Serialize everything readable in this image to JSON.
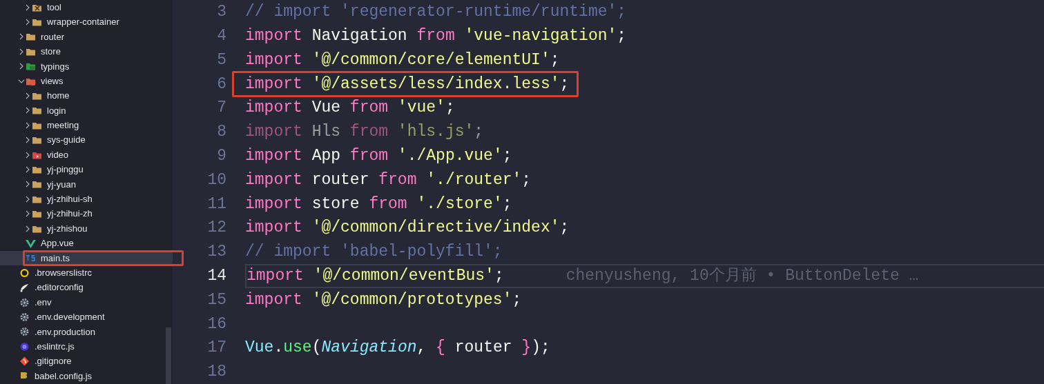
{
  "explorer": {
    "items": [
      {
        "children": [
          {
            "children": [
              {
                "label": "tool",
                "kind": "tools-folder",
                "expanded": false,
                "selected": false,
                "annotated": false
              },
              {
                "label": "wrapper-container",
                "kind": "folder",
                "expanded": false,
                "selected": false,
                "annotated": false
              }
            ]
          },
          {
            "label": "router",
            "kind": "folder",
            "expanded": false,
            "selected": false,
            "annotated": false
          },
          {
            "label": "store",
            "kind": "folder",
            "expanded": false,
            "selected": false,
            "annotated": false
          },
          {
            "label": "typings",
            "kind": "typescript-folder",
            "expanded": false,
            "selected": false,
            "annotated": false
          },
          {
            "label": "views",
            "kind": "views-folder",
            "expanded": true,
            "selected": false,
            "annotated": false,
            "children": [
              {
                "label": "home",
                "kind": "folder",
                "expanded": false,
                "selected": false,
                "annotated": false
              },
              {
                "label": "login",
                "kind": "folder",
                "expanded": false,
                "selected": false,
                "annotated": false
              },
              {
                "label": "meeting",
                "kind": "folder",
                "expanded": false,
                "selected": false,
                "annotated": false
              },
              {
                "label": "sys-guide",
                "kind": "folder",
                "expanded": false,
                "selected": false,
                "annotated": false
              },
              {
                "label": "video",
                "kind": "video-folder",
                "expanded": false,
                "selected": false,
                "annotated": false
              },
              {
                "label": "yj-pinggu",
                "kind": "folder",
                "expanded": false,
                "selected": false,
                "annotated": false
              },
              {
                "label": "yj-yuan",
                "kind": "folder",
                "expanded": false,
                "selected": false,
                "annotated": false
              },
              {
                "label": "yj-zhihui-sh",
                "kind": "folder",
                "expanded": false,
                "selected": false,
                "annotated": false
              },
              {
                "label": "yj-zhihui-zh",
                "kind": "folder",
                "expanded": false,
                "selected": false,
                "annotated": false
              },
              {
                "label": "yj-zhishou",
                "kind": "folder",
                "expanded": false,
                "selected": false,
                "annotated": false
              }
            ]
          },
          {
            "label": "App.vue",
            "kind": "vue-file",
            "selected": false,
            "annotated": false
          },
          {
            "label": "main.ts",
            "kind": "ts-file",
            "selected": true,
            "annotated": true
          }
        ]
      },
      {
        "label": ".browserslistrc",
        "kind": "browserslist-file",
        "selected": false,
        "annotated": false
      },
      {
        "label": ".editorconfig",
        "kind": "editorconfig-file",
        "selected": false,
        "annotated": false
      },
      {
        "label": ".env",
        "kind": "env-file",
        "selected": false,
        "annotated": false
      },
      {
        "label": ".env.development",
        "kind": "env-file",
        "selected": false,
        "annotated": false
      },
      {
        "label": ".env.production",
        "kind": "env-file",
        "selected": false,
        "annotated": false
      },
      {
        "label": ".eslintrc.js",
        "kind": "eslint-file",
        "selected": false,
        "annotated": false
      },
      {
        "label": ".gitignore",
        "kind": "git-file",
        "selected": false,
        "annotated": false
      },
      {
        "label": "babel.config.js",
        "kind": "babel-file",
        "selected": false,
        "annotated": false
      }
    ]
  },
  "editor": {
    "lines": [
      {
        "number": "3",
        "current": false,
        "dimmed": false,
        "annotated": false,
        "tokens": [
          {
            "kind": "comment",
            "text": "// import 'regenerator-runtime/runtime';"
          }
        ]
      },
      {
        "number": "4",
        "current": false,
        "dimmed": false,
        "annotated": false,
        "tokens": [
          {
            "kind": "keyword",
            "text": "import"
          },
          {
            "kind": "plain",
            "text": " Navigation "
          },
          {
            "kind": "keyword",
            "text": "from"
          },
          {
            "kind": "string",
            "text": " 'vue-navigation'"
          },
          {
            "kind": "plain",
            "text": ";"
          }
        ]
      },
      {
        "number": "5",
        "current": false,
        "dimmed": false,
        "annotated": false,
        "tokens": [
          {
            "kind": "keyword",
            "text": "import"
          },
          {
            "kind": "string",
            "text": " '@/common/core/elementUI'"
          },
          {
            "kind": "plain",
            "text": ";"
          }
        ]
      },
      {
        "number": "6",
        "current": false,
        "dimmed": false,
        "annotated": true,
        "tokens": [
          {
            "kind": "keyword",
            "text": "import"
          },
          {
            "kind": "string",
            "text": " '@/assets/less/index.less'"
          },
          {
            "kind": "plain",
            "text": ";"
          }
        ]
      },
      {
        "number": "7",
        "current": false,
        "dimmed": false,
        "annotated": false,
        "tokens": [
          {
            "kind": "keyword",
            "text": "import"
          },
          {
            "kind": "plain",
            "text": " Vue "
          },
          {
            "kind": "keyword",
            "text": "from"
          },
          {
            "kind": "string",
            "text": " 'vue'"
          },
          {
            "kind": "plain",
            "text": ";"
          }
        ]
      },
      {
        "number": "8",
        "current": false,
        "dimmed": true,
        "annotated": false,
        "tokens": [
          {
            "kind": "keyword",
            "text": "import"
          },
          {
            "kind": "plain",
            "text": " Hls "
          },
          {
            "kind": "keyword",
            "text": "from"
          },
          {
            "kind": "string",
            "text": " 'hls.js'"
          },
          {
            "kind": "plain",
            "text": ";"
          }
        ]
      },
      {
        "number": "9",
        "current": false,
        "dimmed": false,
        "annotated": false,
        "tokens": [
          {
            "kind": "keyword",
            "text": "import"
          },
          {
            "kind": "plain",
            "text": " App "
          },
          {
            "kind": "keyword",
            "text": "from"
          },
          {
            "kind": "string",
            "text": " './App.vue'"
          },
          {
            "kind": "plain",
            "text": ";"
          }
        ]
      },
      {
        "number": "10",
        "current": false,
        "dimmed": false,
        "annotated": false,
        "tokens": [
          {
            "kind": "keyword",
            "text": "import"
          },
          {
            "kind": "plain",
            "text": " router "
          },
          {
            "kind": "keyword",
            "text": "from"
          },
          {
            "kind": "string",
            "text": " './router'"
          },
          {
            "kind": "plain",
            "text": ";"
          }
        ]
      },
      {
        "number": "11",
        "current": false,
        "dimmed": false,
        "annotated": false,
        "tokens": [
          {
            "kind": "keyword",
            "text": "import"
          },
          {
            "kind": "plain",
            "text": " store "
          },
          {
            "kind": "keyword",
            "text": "from"
          },
          {
            "kind": "string",
            "text": " './store'"
          },
          {
            "kind": "plain",
            "text": ";"
          }
        ]
      },
      {
        "number": "12",
        "current": false,
        "dimmed": false,
        "annotated": false,
        "tokens": [
          {
            "kind": "keyword",
            "text": "import"
          },
          {
            "kind": "string",
            "text": " '@/common/directive/index'"
          },
          {
            "kind": "plain",
            "text": ";"
          }
        ]
      },
      {
        "number": "13",
        "current": false,
        "dimmed": false,
        "annotated": false,
        "tokens": [
          {
            "kind": "comment",
            "text": "// import 'babel-polyfill';"
          }
        ]
      },
      {
        "number": "14",
        "current": true,
        "dimmed": false,
        "annotated": false,
        "blame": "chenyusheng, 10个月前 • ButtonDelete …",
        "tokens": [
          {
            "kind": "keyword",
            "text": "import"
          },
          {
            "kind": "string",
            "text": " '@/common/eventBus'"
          },
          {
            "kind": "plain",
            "text": ";"
          }
        ]
      },
      {
        "number": "15",
        "current": false,
        "dimmed": false,
        "annotated": false,
        "tokens": [
          {
            "kind": "keyword",
            "text": "import"
          },
          {
            "kind": "string",
            "text": " '@/common/prototypes'"
          },
          {
            "kind": "plain",
            "text": ";"
          }
        ]
      },
      {
        "number": "16",
        "current": false,
        "dimmed": false,
        "annotated": false
      },
      {
        "number": "17",
        "current": false,
        "dimmed": false,
        "annotated": false,
        "tokens": [
          {
            "kind": "class",
            "text": "Vue"
          },
          {
            "kind": "plain",
            "text": "."
          },
          {
            "kind": "function",
            "text": "use"
          },
          {
            "kind": "plain",
            "text": "("
          },
          {
            "kind": "parameter",
            "text": "Navigation"
          },
          {
            "kind": "plain",
            "text": ", "
          },
          {
            "kind": "brace",
            "text": "{"
          },
          {
            "kind": "plain",
            "text": " router "
          },
          {
            "kind": "brace",
            "text": "}"
          },
          {
            "kind": "plain",
            "text": ");"
          }
        ]
      },
      {
        "number": "18",
        "current": false,
        "dimmed": false,
        "annotated": false
      }
    ]
  }
}
